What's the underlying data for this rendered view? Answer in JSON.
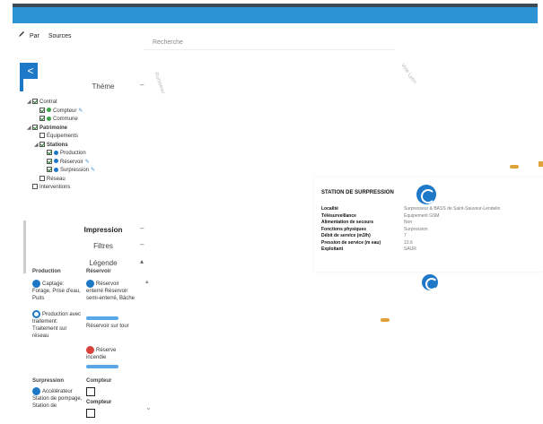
{
  "toolbar": {
    "item1": "Par",
    "item2": "Sources"
  },
  "search": {
    "label": "Recherche"
  },
  "map": {
    "label_left": "Ruisseau",
    "label_right": "Voie Lyon"
  },
  "sidebar": {
    "collapse": "<",
    "theme_title": "Thème",
    "theme_toggle": "–",
    "tree": [
      {
        "label": "Contrat",
        "level": 0,
        "checked": true,
        "expand": "◢",
        "dot": "",
        "bold": false
      },
      {
        "label": "Compteur",
        "level": 1,
        "checked": true,
        "dot": "#3ea24a",
        "tool": "✎",
        "bold": false
      },
      {
        "label": "Commune",
        "level": 1,
        "checked": true,
        "dot": "#3ea24a",
        "bold": false
      },
      {
        "label": "Patrimoine",
        "level": 0,
        "checked": true,
        "expand": "◢",
        "bold": true
      },
      {
        "label": "Équipements",
        "level": 1,
        "checked": false,
        "bold": false
      },
      {
        "label": "Stations",
        "level": 1,
        "checked": true,
        "expand": "◢",
        "bold": true
      },
      {
        "label": "Production",
        "level": 2,
        "checked": true,
        "dot": "#1e78c8",
        "bold": false
      },
      {
        "label": "Réservoir",
        "level": 2,
        "checked": true,
        "dot": "#1e78c8",
        "tool": "✎",
        "bold": false
      },
      {
        "label": "Surpression",
        "level": 2,
        "checked": true,
        "dot": "#1e78c8",
        "tool": "✎",
        "bold": false
      },
      {
        "label": "Réseau",
        "level": 1,
        "checked": false,
        "bold": false
      },
      {
        "label": "Interventions",
        "level": 0,
        "checked": false,
        "bold": false
      }
    ],
    "impression": "Impression",
    "filtres": "Filtres",
    "legende": "Légende",
    "legend": {
      "col1_head": "Production",
      "col2_head": "Réservoir",
      "col1_items": [
        "Captage: Forage, Prise d'eau, Puits",
        "Production avec traitement: Traitement sur réseau"
      ],
      "col2_items": [
        "Réservoir enterré Réservoir semi-enterré, Bâche",
        "Réservoir sur tour",
        "Réserve incendie"
      ],
      "col3_head": "Surpression",
      "col4_head": "Compteur",
      "col3_items": [
        "Accélérateur Station de pompage, Station de"
      ],
      "col4_items": [
        "Compteur"
      ]
    }
  },
  "popup": {
    "title": "STATION DE SURPRESSION",
    "attrs": [
      {
        "k": "Localité",
        "v": "Surpresseur & BASS de Saint-Sauveur-Lendelin"
      },
      {
        "k": "Télésurveillance",
        "v": "Équipement GSM"
      },
      {
        "k": "Alimentation de secours",
        "v": "Non"
      },
      {
        "k": "Fonctions physiques",
        "v": "Surpression"
      },
      {
        "k": "Débit de service (m3/h)",
        "v": "7"
      },
      {
        "k": "Pression de service (m eau)",
        "v": "13.6"
      },
      {
        "k": "Exploitant",
        "v": "SAUR"
      }
    ]
  },
  "colors": {
    "topbar": "#2c93d4",
    "accent": "#1e78c8",
    "marker": "#e0a23a"
  }
}
